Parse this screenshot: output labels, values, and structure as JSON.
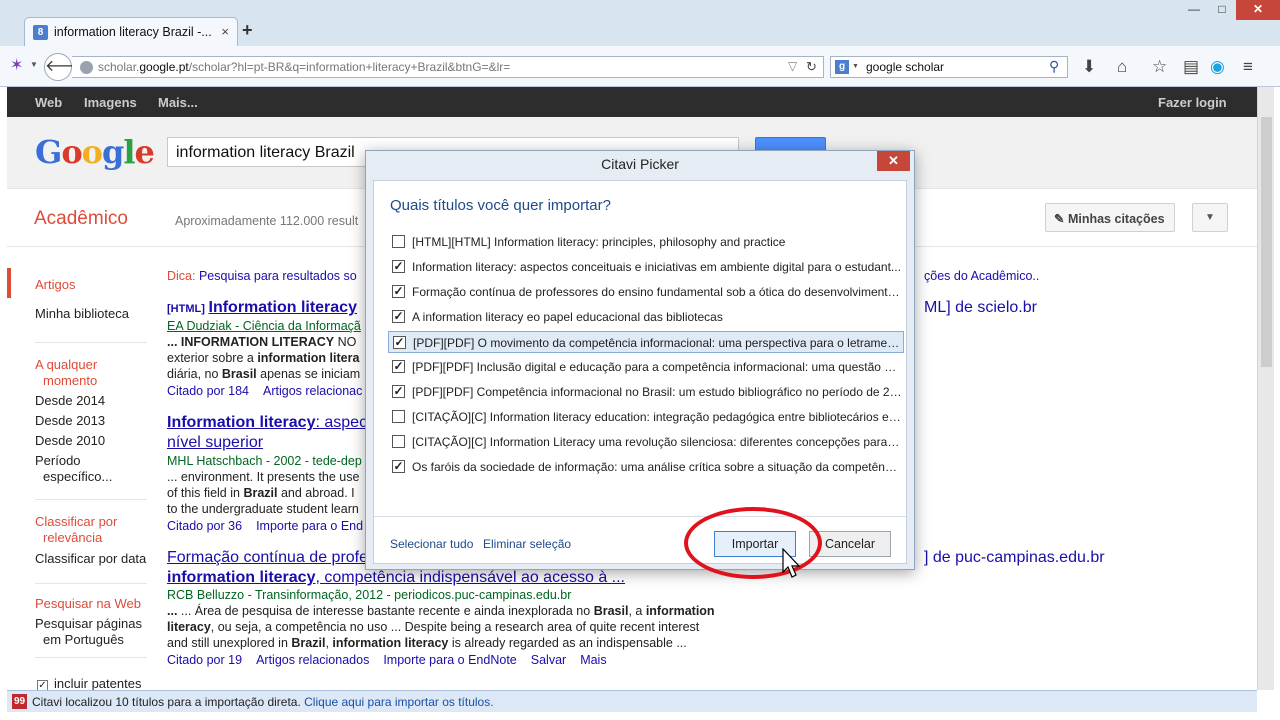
{
  "browser": {
    "tab_title": "information literacy Brazil -...",
    "tab_close": "×",
    "new_tab": "+",
    "win_min": "—",
    "win_max": "□",
    "win_close": "✕",
    "url_prefix": "scholar.",
    "url_domain": "google.pt",
    "url_rest": "/scholar?hl=pt-BR&q=information+literacy+Brazil&btnG=&lr=",
    "search_engine_letter": "g",
    "search_value": "google scholar"
  },
  "scholar": {
    "gbar": [
      "Web",
      "Imagens",
      "Mais..."
    ],
    "login": "Fazer login",
    "logo": [
      "G",
      "o",
      "o",
      "g",
      "l",
      "e"
    ],
    "logo_colors": [
      "#3a6fd8",
      "#d93a2b",
      "#f2b01e",
      "#3a6fd8",
      "#2aa146",
      "#d93a2b"
    ],
    "query": "information literacy Brazil",
    "section": "Acadêmico",
    "result_stats": "Aproximadamente 112.000 result",
    "my_citations": "Minhas citações",
    "sidebar": {
      "articles": "Artigos",
      "library": "Minha biblioteca",
      "any_time_1": "A qualquer",
      "any_time_2": "momento",
      "since_2014": "Desde 2014",
      "since_2013": "Desde 2013",
      "since_2010": "Desde 2010",
      "period_1": "Período",
      "period_2": "específico...",
      "sort_rel_1": "Classificar por",
      "sort_rel_2": "relevância",
      "sort_date": "Classificar por data",
      "search_web": "Pesquisar na Web",
      "search_pt_1": "Pesquisar páginas",
      "search_pt_2": "em Português",
      "patents": "incluir patentes"
    },
    "tip_label": "Dica:",
    "tip_text": "Pesquisa para resultados so",
    "tip_tail": "ções do Acadêmico..",
    "r1_tag": "[HTML]",
    "r1_title": "Information literacy",
    "r1_side": "ML] de scielo.br",
    "r1_authors": "EA Dudziak - Ciência da Informaçã",
    "r1_l1a": "... ",
    "r1_l1b": "INFORMATION LITERACY",
    "r1_l1c": " NO",
    "r1_l2a": "exterior sobre a ",
    "r1_l2b": "information litera",
    "r1_l3a": "diária, no ",
    "r1_l3b": "Brasil",
    "r1_l3c": " apenas se iniciam",
    "r1_cited": "Citado por 184",
    "r1_related": "Artigos relacionac",
    "r2_title_a": "Information literacy",
    "r2_title_b": ": aspec",
    "r2_title_2": "nível superior",
    "r2_authors": "MHL Hatschbach - 2002 - tede-dep",
    "r2_l1": "... environment. It presents the use",
    "r2_l2a": "of this field in ",
    "r2_l2b": "Brazil",
    "r2_l2c": " and abroad. I",
    "r2_l3": "to the undergraduate student learn",
    "r2_cited": "Citado por 36",
    "r2_import": "Importe para o End",
    "r3_title": "Formação contínua de profe",
    "r3_side": "] de puc-campinas.edu.br",
    "r3_title2_a": "information literacy",
    "r3_title2_b": ", competência indispensável ao acesso à ...",
    "r3_authors": "RCB Belluzzo - Transinformação, 2012 - periodicos.puc-campinas.edu.br",
    "r3_l1a": "... Área de pesquisa de interesse bastante recente e ainda inexplorada no ",
    "r3_l1b": "Brasil",
    "r3_l1c": ", a ",
    "r3_l1d": "information",
    "r3_l2a": "literacy",
    "r3_l2b": ", ou seja, a competência no uso ... Despite being a research area of quite recent interest",
    "r3_l3a": "and still unexplored in ",
    "r3_l3b": "Brazil",
    "r3_l3c": ", ",
    "r3_l3d": "information literacy",
    "r3_l3e": " is already regarded as an indispensable ...",
    "r3_links": [
      "Citado por 19",
      "Artigos relacionados",
      "Importe para o EndNote",
      "Salvar",
      "Mais"
    ]
  },
  "status": {
    "text": "Citavi localizou 10 títulos para a importação direta. ",
    "link": "Clique aqui para importar os títulos."
  },
  "dialog": {
    "title": "Citavi Picker",
    "close": "✕",
    "question": "Quais títulos você quer importar?",
    "items": [
      {
        "label": "[HTML][HTML] Information literacy: principles, philosophy and practice",
        "checked": false
      },
      {
        "label": "Information literacy: aspectos conceituais e iniciativas em ambiente digital para o estudant...",
        "checked": true
      },
      {
        "label": "Formação contínua de professores do ensino fundamental sob a ótica do desenvolvimento ...",
        "checked": true
      },
      {
        "label": "A information literacy eo papel educacional das bibliotecas",
        "checked": true
      },
      {
        "label": "[PDF][PDF] O movimento da competência informacional: uma perspectiva para o letramen...",
        "checked": true
      },
      {
        "label": "[PDF][PDF] Inclusão digital e educação para a competência informacional: uma questão de ...",
        "checked": true
      },
      {
        "label": "[PDF][PDF] Competência informacional no Brasil: um estudo bibliográfico no período de 20...",
        "checked": true
      },
      {
        "label": "[CITAÇÃO][C] Information literacy education: integração pedagógica entre bibliotecários e ...",
        "checked": false
      },
      {
        "label": "[CITAÇÃO][C] Information Literacy uma revolução silenciosa: diferentes concepções para a...",
        "checked": false
      },
      {
        "label": "Os faróis da sociedade de informação: uma análise crítica sobre a situação da competência ...",
        "checked": true
      }
    ],
    "select_all": "Selecionar tudo",
    "clear_selection": "Eliminar seleção",
    "import_btn": "Importar",
    "cancel_btn": "Cancelar"
  },
  "colors": {
    "accent_red": "#dd4b39",
    "link_blue": "#1a0dab",
    "annotation_red": "#e0121b"
  }
}
